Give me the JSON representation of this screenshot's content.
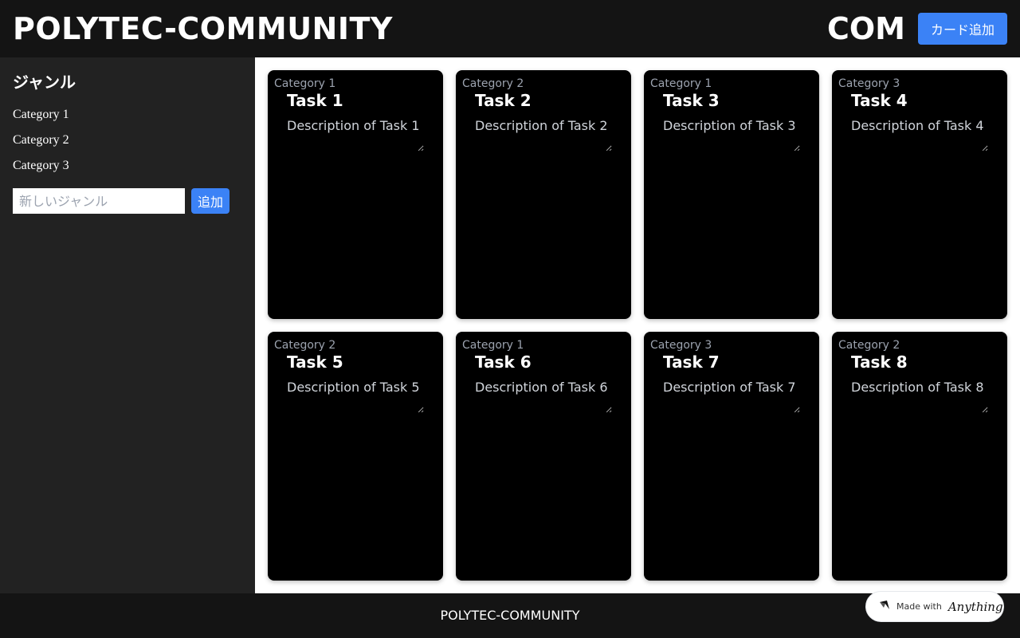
{
  "header": {
    "brand": "POLYTEC-COMMUNITY",
    "short_title": "COM",
    "add_card_label": "カード追加"
  },
  "sidebar": {
    "title": "ジャンル",
    "categories": [
      "Category 1",
      "Category 2",
      "Category 3"
    ],
    "new_genre_placeholder": "新しいジャンル",
    "add_label": "追加"
  },
  "cards": [
    {
      "category": "Category 1",
      "title": "Task 1",
      "description": "Description of Task 1"
    },
    {
      "category": "Category 2",
      "title": "Task 2",
      "description": "Description of Task 2"
    },
    {
      "category": "Category 1",
      "title": "Task 3",
      "description": "Description of Task 3"
    },
    {
      "category": "Category 3",
      "title": "Task 4",
      "description": "Description of Task 4"
    },
    {
      "category": "Category 2",
      "title": "Task 5",
      "description": "Description of Task 5"
    },
    {
      "category": "Category 1",
      "title": "Task 6",
      "description": "Description of Task 6"
    },
    {
      "category": "Category 3",
      "title": "Task 7",
      "description": "Description of Task 7"
    },
    {
      "category": "Category 2",
      "title": "Task 8",
      "description": "Description of Task 8"
    }
  ],
  "footer": {
    "text": "POLYTEC-COMMUNITY",
    "badge_text": "Made with",
    "badge_brand": "Anything",
    "badge_icon": "anything-logo-icon"
  },
  "colors": {
    "header_bg": "#141414",
    "sidebar_bg": "#222222",
    "card_bg": "#000000",
    "accent": "#3b82f6"
  }
}
